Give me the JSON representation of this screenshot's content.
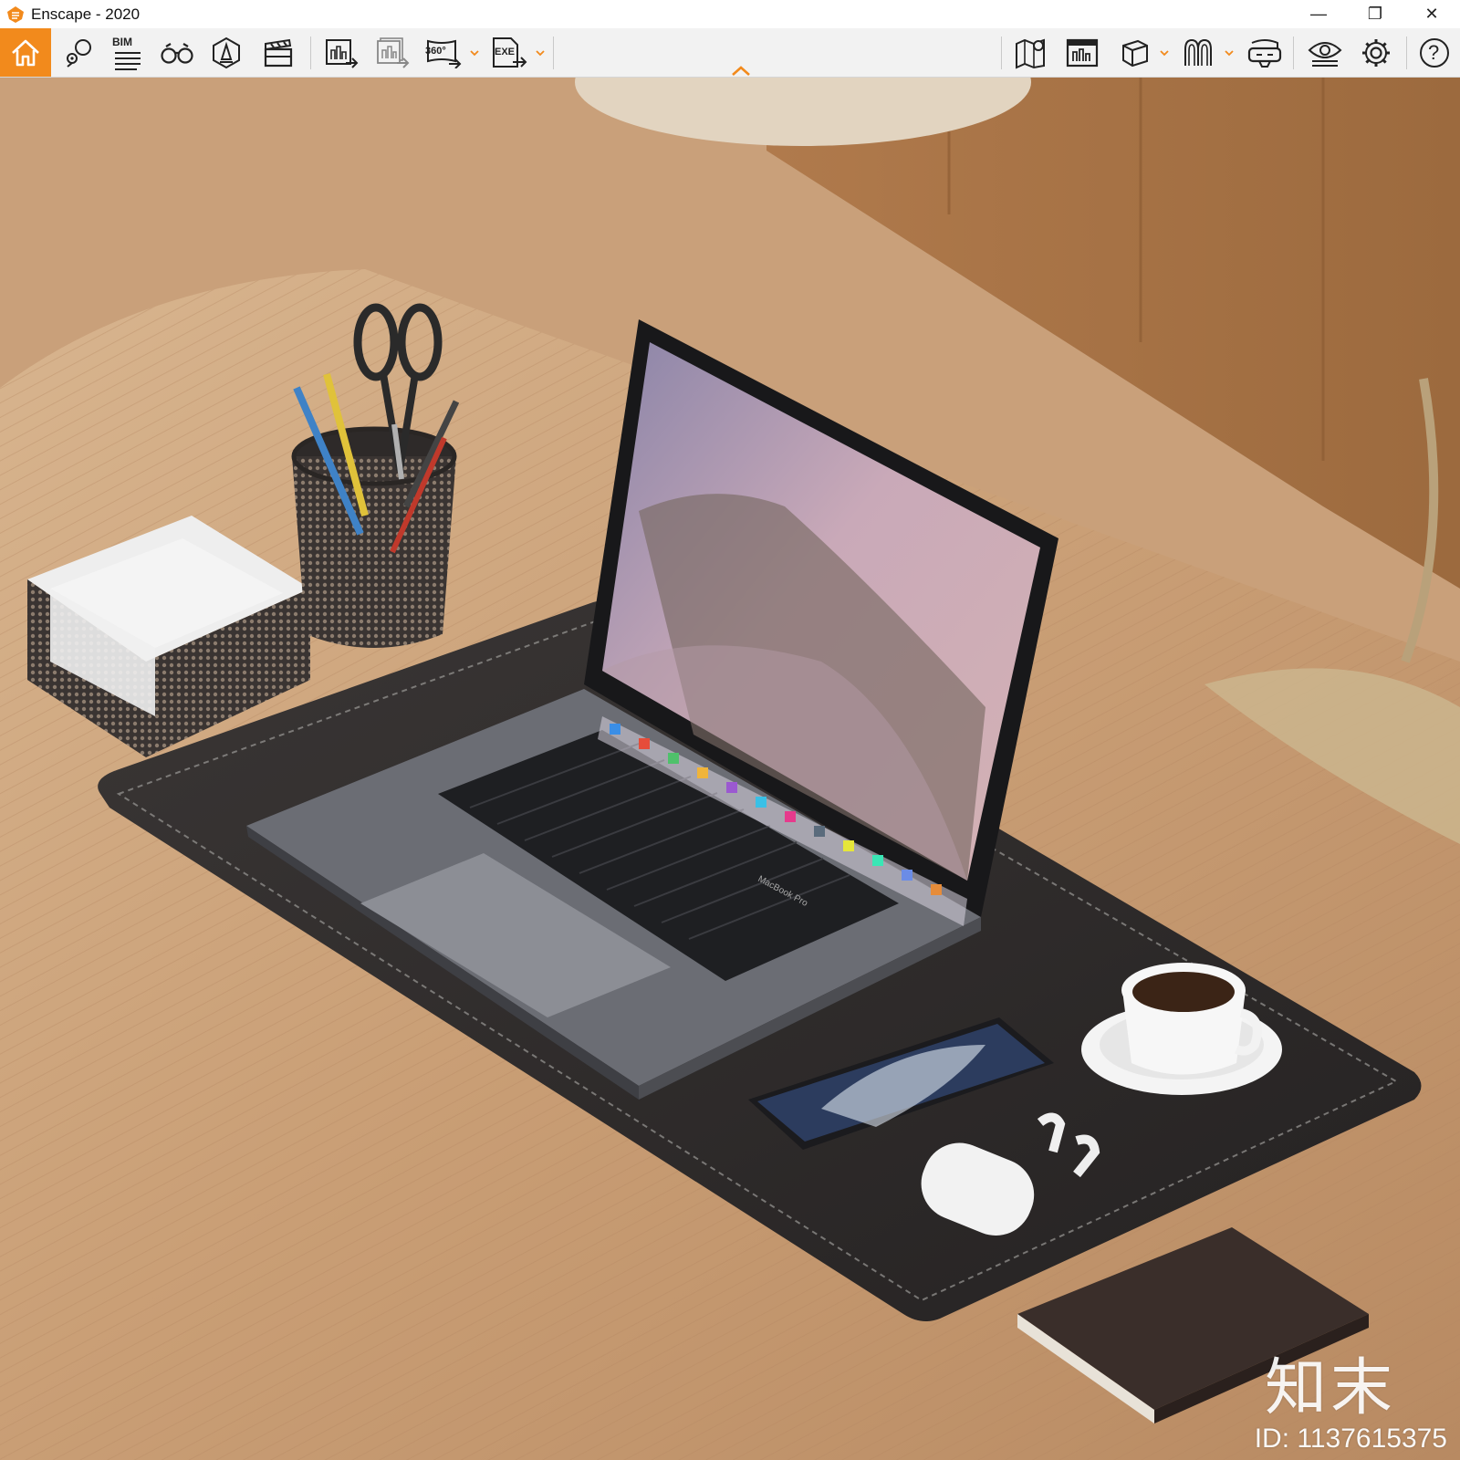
{
  "window": {
    "title": "Enscape - 2020",
    "controls": {
      "minimize": "—",
      "restore": "❐",
      "close": "✕"
    }
  },
  "toolbar": {
    "accent_color": "#f28a1c",
    "left_tools": [
      {
        "icon": "home-icon",
        "active": true
      },
      {
        "icon": "location-pins-icon"
      },
      {
        "icon": "bim-list-icon",
        "label": "BIM"
      },
      {
        "icon": "binoculars-icon"
      },
      {
        "icon": "sun-brightness-icon"
      },
      {
        "icon": "clapperboard-icon"
      }
    ],
    "export_tools": [
      {
        "icon": "screenshot-export-icon"
      },
      {
        "icon": "batch-export-icon"
      },
      {
        "icon": "panorama-export-icon",
        "label": "360°",
        "has_dropdown": true
      },
      {
        "icon": "exe-export-icon",
        "label": "EXE",
        "has_dropdown": true
      }
    ],
    "right_tools": [
      {
        "icon": "map-pin-icon"
      },
      {
        "icon": "asset-library-icon"
      },
      {
        "icon": "cube-view-icon",
        "has_dropdown": true
      },
      {
        "icon": "material-editor-icon",
        "has_dropdown": true
      },
      {
        "icon": "vr-headset-icon"
      },
      {
        "icon": "visual-settings-eye-icon"
      },
      {
        "icon": "settings-gear-icon"
      },
      {
        "icon": "help-icon",
        "label": "?"
      }
    ]
  },
  "viewport": {
    "watermark_brand": "知末",
    "watermark_id": "ID: 1137615375",
    "laptop_label": "MacBook Pro"
  }
}
